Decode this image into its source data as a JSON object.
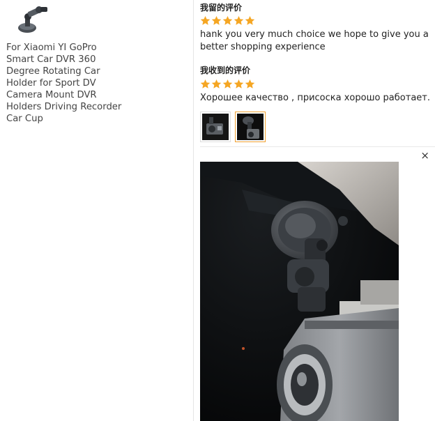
{
  "product": {
    "title_lines": [
      "For Xiaomi YI GoPro",
      "Smart Car DVR 360",
      "Degree Rotating Car",
      "Holder for Sport DV",
      "Camera Mount DVR",
      "Holders Driving Recorder",
      "Car Cup"
    ],
    "thumb_icon": "suction-cup-mount-icon"
  },
  "reviews": [
    {
      "heading": "我留的评价",
      "rating": 5,
      "text": "hank you very much choice we hope to give you a better shopping experience"
    },
    {
      "heading": "我收到的评价",
      "rating": 5,
      "text": "Хорошее качество , присоска хорошо работает."
    }
  ],
  "gallery": {
    "thumbnails": [
      {
        "icon": "dashcam-photo-thumbnail",
        "active": false
      },
      {
        "icon": "mount-photo-thumbnail",
        "active": true
      }
    ],
    "close_label": "×"
  },
  "colors": {
    "star": "#f5a623",
    "active_border": "#f0a030"
  }
}
